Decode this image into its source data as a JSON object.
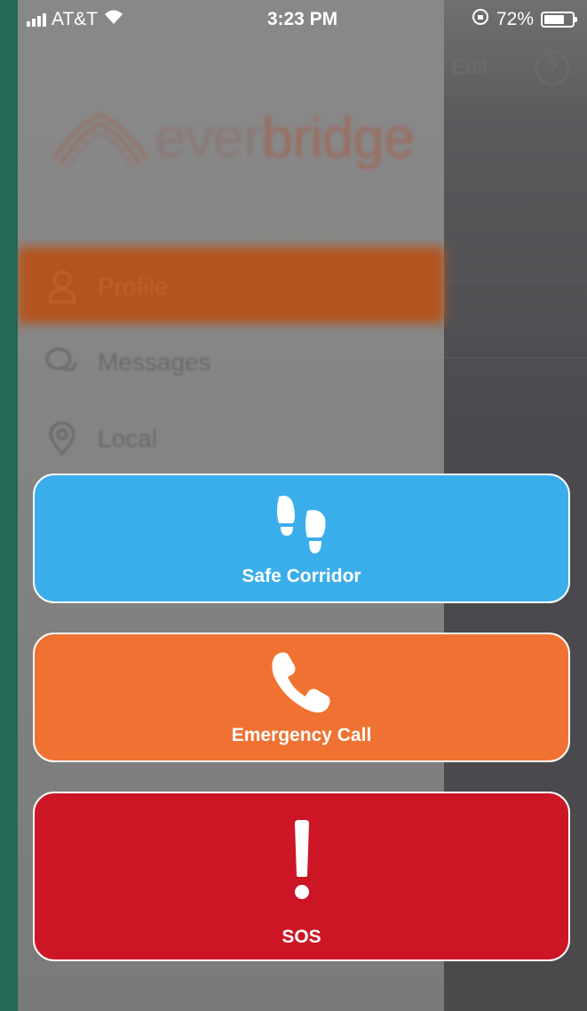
{
  "status_bar": {
    "carrier": "AT&T",
    "time": "3:23 PM",
    "battery_percent": "72%",
    "battery_level": 0.72,
    "icons": [
      "cellular-signal-icon",
      "wifi-icon",
      "rotation-lock-icon",
      "battery-icon"
    ]
  },
  "background_app": {
    "edit_label": "Edit",
    "help_label": "?"
  },
  "drawer": {
    "logo_text_a": "ever",
    "logo_text_b": "bridge",
    "menu": [
      {
        "label": "Profile",
        "icon": "person-icon",
        "active": true
      },
      {
        "label": "Messages",
        "icon": "chat-bubbles-icon",
        "active": false
      },
      {
        "label": "Local",
        "icon": "location-pin-icon",
        "active": false
      }
    ]
  },
  "actions": [
    {
      "label": "Safe Corridor",
      "icon": "footprints-icon",
      "color": "#3aaeea"
    },
    {
      "label": "Emergency Call",
      "icon": "phone-icon",
      "color": "#f07232"
    },
    {
      "label": "SOS",
      "icon": "exclamation-icon",
      "color": "#cc1626"
    }
  ],
  "colors": {
    "frame_background": "#236956",
    "overlay_gray": "#7c7c7c",
    "brand_orange": "#b4531d"
  }
}
